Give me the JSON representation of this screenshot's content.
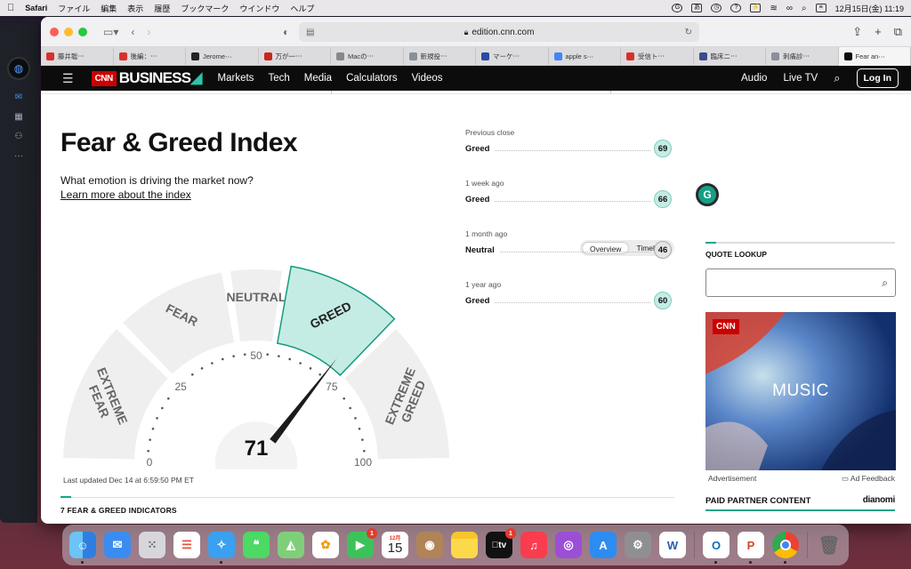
{
  "menubar": {
    "app_name": "Safari",
    "menus": [
      "ファイル",
      "編集",
      "表示",
      "履歴",
      "ブックマーク",
      "ウインドウ",
      "ヘルプ"
    ],
    "clock": "12月15日(金)  11:19",
    "input_method": "あ"
  },
  "browser": {
    "url": "edition.cnn.com",
    "tabs": [
      {
        "label": "藤井聡⋯",
        "color": "#d9302c"
      },
      {
        "label": "後編：⋯",
        "color": "#d9302c"
      },
      {
        "label": "Jerome⋯",
        "color": "#222222"
      },
      {
        "label": "万が一⋯",
        "color": "#c8281e"
      },
      {
        "label": "Macの⋯",
        "color": "#888888"
      },
      {
        "label": "新規投⋯",
        "color": "#8a8f99"
      },
      {
        "label": "マーケ⋯",
        "color": "#2b4aa0"
      },
      {
        "label": "apple s⋯",
        "color": "#4285f4"
      },
      {
        "label": "受信ト⋯",
        "color": "#d93025"
      },
      {
        "label": "臨床ニ⋯",
        "color": "#3b4b8c"
      },
      {
        "label": "刺痛診⋯",
        "color": "#8a8f99"
      },
      {
        "label": "Fear an⋯",
        "color": "#0c0c0c"
      }
    ]
  },
  "cnn_nav": {
    "logo": "CNN",
    "section": "BUSINESS",
    "links": [
      "Markets",
      "Tech",
      "Media",
      "Calculators",
      "Videos"
    ],
    "audio": "Audio",
    "live_tv": "Live TV",
    "login": "Log In"
  },
  "page": {
    "title": "Fear & Greed Index",
    "subtitle": "What emotion is driving the market now?",
    "learn_more": "Learn more about the index",
    "toggle": {
      "overview": "Overview",
      "timeline": "Timeline"
    },
    "last_updated": "Last updated Dec 14 at 6:59:50 PM ET",
    "indicators_header": "7 FEAR & GREED INDICATORS"
  },
  "gauge": {
    "value": 71,
    "segments": [
      "EXTREME FEAR",
      "FEAR",
      "NEUTRAL",
      "GREED",
      "EXTREME GREED"
    ],
    "active_segment": "GREED",
    "scale_labels": [
      "0",
      "25",
      "50",
      "75",
      "100"
    ],
    "colors": {
      "active": "#c5ece4",
      "active_border": "#159a82",
      "inactive": "#efefef",
      "needle": "#1b1b1b"
    }
  },
  "history": [
    {
      "label": "Previous close",
      "rating": "Greed",
      "value": "69",
      "color": "#c5ece4"
    },
    {
      "label": "1 week ago",
      "rating": "Greed",
      "value": "66",
      "color": "#c5ece4"
    },
    {
      "label": "1 month ago",
      "rating": "Neutral",
      "value": "46",
      "color": "#e5e5e5"
    },
    {
      "label": "1 year ago",
      "rating": "Greed",
      "value": "60",
      "color": "#c5ece4"
    }
  ],
  "sidebar": {
    "quote_lookup": "QUOTE LOOKUP",
    "ad_logo": "CNN",
    "ad_text": "MUSIC",
    "ad_caption": "Advertisement",
    "ad_feedback": "Ad Feedback",
    "paid_content": "PAID PARTNER CONTENT",
    "paid_logo": "dianomi"
  },
  "dock": {
    "calendar_month": "12月",
    "calendar_day": "15",
    "facetime_badge": "1",
    "tv_badge": "1",
    "tv_label": "tv"
  }
}
